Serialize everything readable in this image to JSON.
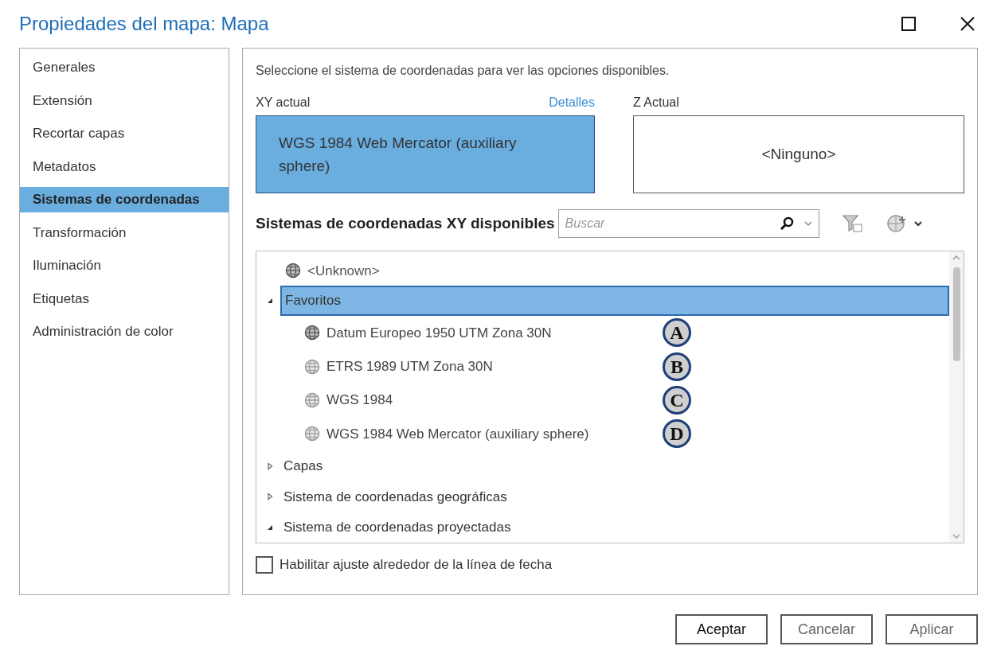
{
  "window": {
    "title": "Propiedades del mapa: Mapa"
  },
  "sidebar": {
    "items": [
      {
        "label": "Generales",
        "selected": false
      },
      {
        "label": "Extensión",
        "selected": false
      },
      {
        "label": "Recortar capas",
        "selected": false
      },
      {
        "label": "Metadatos",
        "selected": false
      },
      {
        "label": "Sistemas de coordenadas",
        "selected": true
      },
      {
        "label": "Transformación",
        "selected": false
      },
      {
        "label": "Iluminación",
        "selected": false
      },
      {
        "label": "Etiquetas",
        "selected": false
      },
      {
        "label": "Administración de color",
        "selected": false
      }
    ]
  },
  "instruction": "Seleccione el sistema de coordenadas para ver las opciones disponibles.",
  "xy_current": {
    "label": "XY actual",
    "details_link": "Detalles",
    "value": "WGS 1984 Web Mercator (auxiliary sphere)"
  },
  "z_current": {
    "label": "Z Actual",
    "value": "<Ninguno>"
  },
  "available": {
    "heading": "Sistemas de coordenadas XY disponibles",
    "search": {
      "placeholder": "Buscar"
    }
  },
  "tree": [
    {
      "kind": "leaf",
      "label": "<Unknown>"
    },
    {
      "kind": "folder",
      "label": "Favoritos",
      "expanded": true,
      "selected": true,
      "children": [
        {
          "label": "Datum Europeo 1950 UTM Zona 30N",
          "callout": "A"
        },
        {
          "label": "ETRS 1989 UTM Zona 30N",
          "callout": "B"
        },
        {
          "label": "WGS 1984",
          "callout": "C"
        },
        {
          "label": "WGS 1984 Web Mercator (auxiliary sphere)",
          "callout": "D"
        }
      ]
    },
    {
      "kind": "folder",
      "label": "Capas",
      "expanded": false,
      "selected": false
    },
    {
      "kind": "folder",
      "label": "Sistema de coordenadas geográficas",
      "expanded": false,
      "selected": false
    },
    {
      "kind": "folder",
      "label": "Sistema de coordenadas proyectadas",
      "expanded": true,
      "selected": false
    }
  ],
  "dateline_checkbox": {
    "label": "Habilitar ajuste alrededor de la línea de fecha",
    "checked": false
  },
  "buttons": [
    "Aceptar",
    "Cancelar",
    "Aplicar"
  ]
}
